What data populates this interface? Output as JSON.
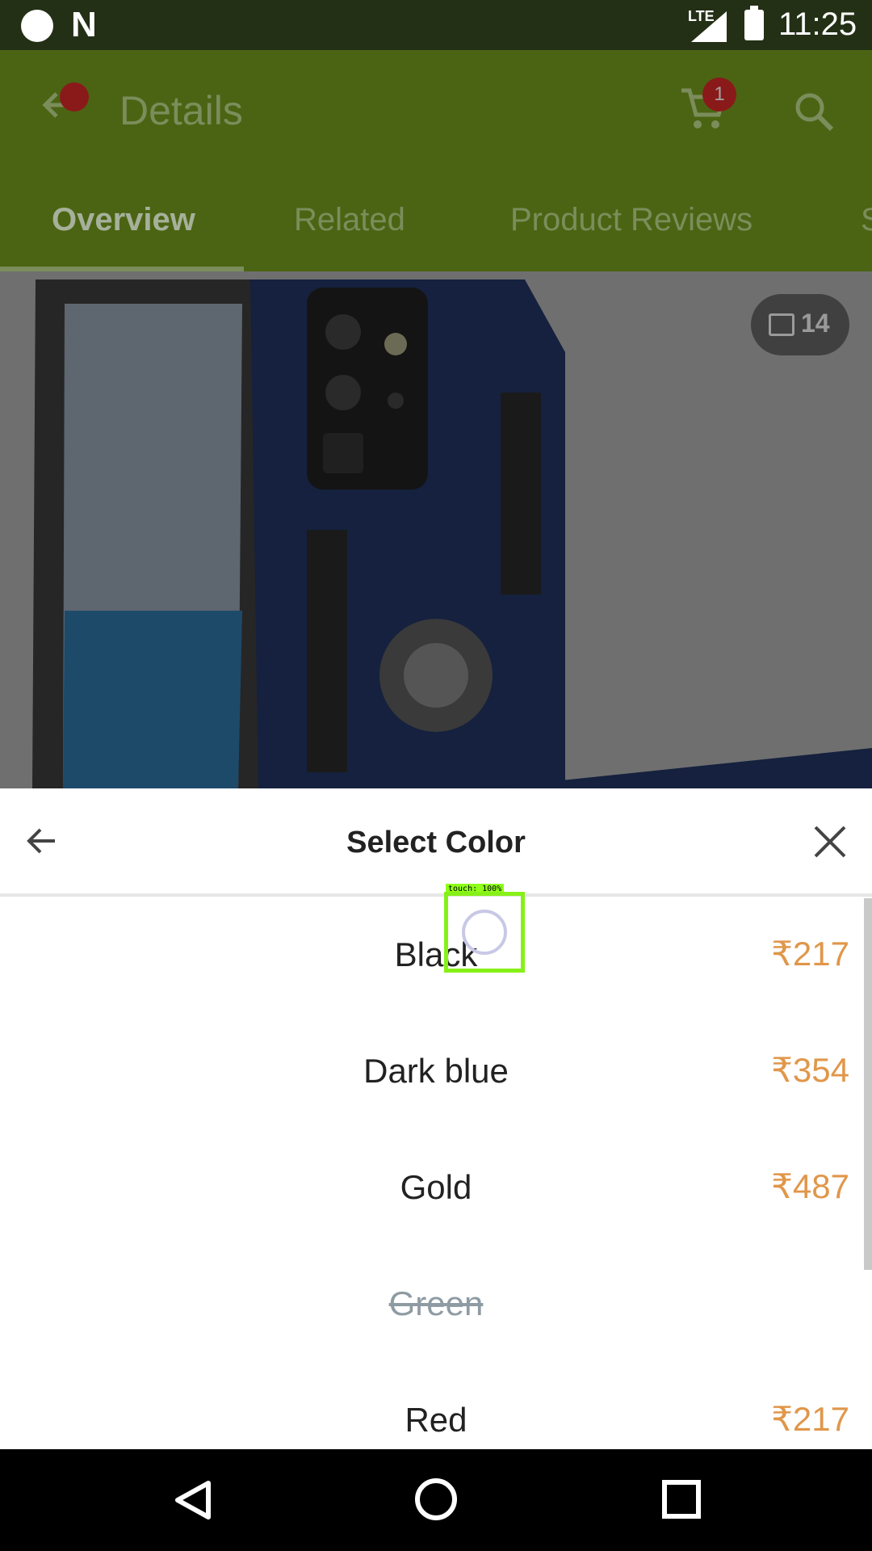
{
  "status_bar": {
    "time": "11:25",
    "network": "LTE"
  },
  "app_bar": {
    "title": "Details",
    "cart_count": "1"
  },
  "tabs": [
    {
      "label": "Overview"
    },
    {
      "label": "Related"
    },
    {
      "label": "Product Reviews"
    },
    {
      "label": "S"
    }
  ],
  "gallery": {
    "image_count": "14"
  },
  "sheet": {
    "title": "Select Color",
    "options": [
      {
        "name": "Black",
        "price": "₹217",
        "available": true
      },
      {
        "name": "Dark blue",
        "price": "₹354",
        "available": true
      },
      {
        "name": "Gold",
        "price": "₹487",
        "available": true
      },
      {
        "name": "Green",
        "price": "",
        "available": false
      },
      {
        "name": "Red",
        "price": "₹217",
        "available": true
      }
    ]
  },
  "touch_indicator": {
    "label": "touch: 100%"
  },
  "colors": {
    "accent": "#4b6413",
    "price": "#e0974a",
    "disabled": "#8e9ba3"
  }
}
